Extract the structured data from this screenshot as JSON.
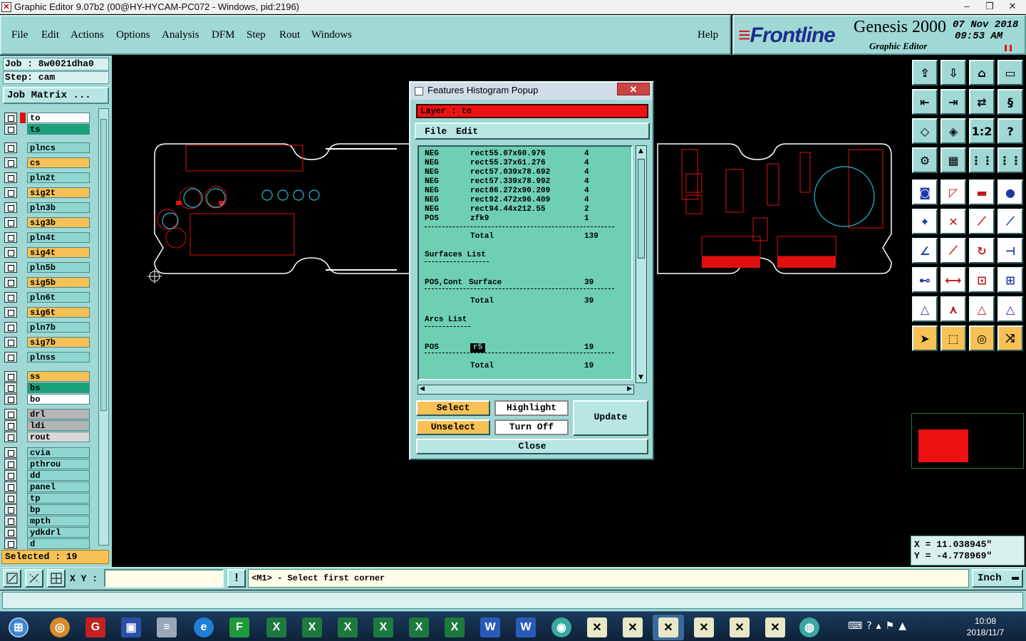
{
  "window": {
    "title": "Graphic Editor 9.07b2 (00@HY-HYCAM-PC072 - Windows, pid:2196)"
  },
  "menu": {
    "items": [
      "File",
      "Edit",
      "Actions",
      "Options",
      "Analysis",
      "DFM",
      "Step",
      "Rout",
      "Windows"
    ],
    "help": "Help"
  },
  "brand": {
    "logo": "Frontline",
    "product": "Genesis 2000",
    "subtitle": "Graphic Editor",
    "date": "07 Nov 2018",
    "time": "09:53 AM"
  },
  "job": {
    "job_line": "Job : 8w0021dha0",
    "step_line": "Step: cam",
    "matrix_button": "Job Matrix ..."
  },
  "layers": [
    {
      "name": "to",
      "color": "#ffffff",
      "state": "work"
    },
    {
      "name": "ts",
      "color": "#1aa37a"
    },
    {
      "name": "plncs",
      "color": "#8fd6d0"
    },
    {
      "name": "cs",
      "color": "#f7c156"
    },
    {
      "name": "pln2t",
      "color": "#8fd6d0"
    },
    {
      "name": "sig2t",
      "color": "#f7c156"
    },
    {
      "name": "pln3b",
      "color": "#8fd6d0"
    },
    {
      "name": "sig3b",
      "color": "#f7c156"
    },
    {
      "name": "pln4t",
      "color": "#8fd6d0"
    },
    {
      "name": "sig4t",
      "color": "#f7c156"
    },
    {
      "name": "pln5b",
      "color": "#8fd6d0"
    },
    {
      "name": "sig5b",
      "color": "#f7c156"
    },
    {
      "name": "pln6t",
      "color": "#8fd6d0"
    },
    {
      "name": "sig6t",
      "color": "#f7c156"
    },
    {
      "name": "pln7b",
      "color": "#8fd6d0"
    },
    {
      "name": "sig7b",
      "color": "#f7c156"
    },
    {
      "name": "plnss",
      "color": "#8fd6d0"
    },
    {
      "name": "ss",
      "color": "#f7c156"
    },
    {
      "name": "bs",
      "color": "#1aa37a"
    },
    {
      "name": "bo",
      "color": "#ffffff"
    },
    {
      "name": "drl",
      "color": "#b5b5b5"
    },
    {
      "name": "ldi",
      "color": "#b5b5b5"
    },
    {
      "name": "rout",
      "color": "#d8d8d8"
    },
    {
      "name": "cvia",
      "color": "#8fd6d0"
    },
    {
      "name": "pthrou",
      "color": "#8fd6d0"
    },
    {
      "name": "dd",
      "color": "#8fd6d0"
    },
    {
      "name": "panel",
      "color": "#8fd6d0"
    },
    {
      "name": "tp",
      "color": "#8fd6d0"
    },
    {
      "name": "bp",
      "color": "#8fd6d0"
    },
    {
      "name": "mpth",
      "color": "#8fd6d0"
    },
    {
      "name": "ydkdrl",
      "color": "#8fd6d0"
    },
    {
      "name": "d",
      "color": "#8fd6d0"
    }
  ],
  "selected": "Selected : 19",
  "popup": {
    "title": "Features Histogram Popup",
    "close_glyph": "✕",
    "layer": "Layer :  to",
    "menu": [
      "File",
      "Edit"
    ],
    "rows": [
      {
        "pol": "NEG",
        "sym": "rect55.07x60.976",
        "count": "4"
      },
      {
        "pol": "NEG",
        "sym": "rect55.37x61.276",
        "count": "4"
      },
      {
        "pol": "NEG",
        "sym": "rect57.039x78.692",
        "count": "4"
      },
      {
        "pol": "NEG",
        "sym": "rect57.339x78.992",
        "count": "4"
      },
      {
        "pol": "NEG",
        "sym": "rect86.272x90.209",
        "count": "4"
      },
      {
        "pol": "NEG",
        "sym": "rect92.472x96.409",
        "count": "4"
      },
      {
        "pol": "NEG",
        "sym": "rect94.44x212.55",
        "count": "2"
      },
      {
        "pol": "POS",
        "sym": "zfk9",
        "count": "1"
      }
    ],
    "total_label": "Total",
    "pads_total": "139",
    "surfaces_header": "Surfaces List",
    "surface_row": {
      "pol": "POS,Cont",
      "sym": "Surface",
      "count": "39"
    },
    "surfaces_total": "39",
    "arcs_header": "Arcs List",
    "arc_row": {
      "pol": "POS",
      "sym": "r5",
      "count": "19"
    },
    "arcs_total": "19",
    "buttons": {
      "select": "Select",
      "highlight": "Highlight",
      "update": "Update",
      "unselect": "Unselect",
      "turn_off": "Turn Off",
      "close": "Close"
    }
  },
  "coords": {
    "x": "X = 11.038945\"",
    "y": "Y = -4.778969\""
  },
  "status": {
    "xy_label": "X Y :",
    "xy_value": "",
    "warn": "!",
    "prompt": "<M1> - Select first corner",
    "units": "Inch"
  },
  "taskbar": {
    "time": "10:08",
    "date": "2018/11/7"
  },
  "colors": {
    "panel": "#9fd8d4",
    "accent_red": "#ee1111",
    "annotation_arrow": "#f2f21a",
    "active_layer": "#f7c156"
  }
}
